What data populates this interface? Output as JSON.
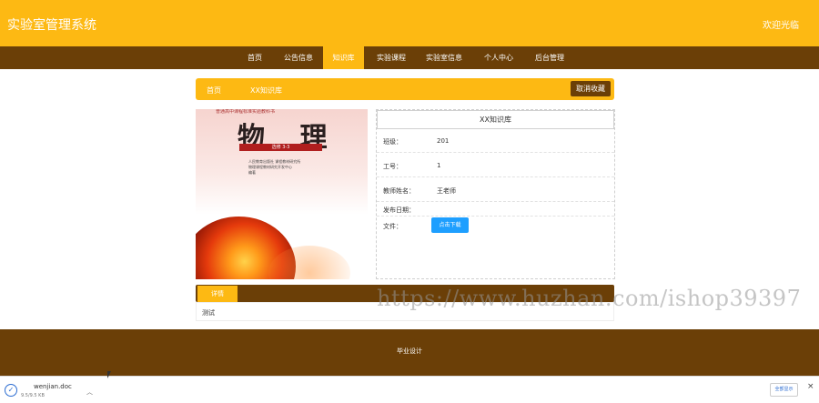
{
  "header": {
    "site_title": "实验室管理系统",
    "welcome": "欢迎光临"
  },
  "nav": {
    "items": [
      "首页",
      "公告信息",
      "知识库",
      "实验课程",
      "实验室信息",
      "个人中心",
      "后台管理"
    ],
    "active_index": 2
  },
  "breadcrumb": {
    "home": "首页",
    "current": "XX知识库",
    "favorite_button": "取消收藏"
  },
  "cover": {
    "top_text": "普通高中课程标准实验教科书",
    "title": "物 理",
    "band_text": "选修 3-3",
    "publisher_line1": "人民教育出版社  课程教材研究所",
    "publisher_line2": "物理课程教材研究开发中心",
    "publisher_suffix": "编著"
  },
  "detail": {
    "heading": "XX知识库",
    "rows": [
      {
        "label": "班级：",
        "value": "201"
      },
      {
        "label": "工号：",
        "value": "1"
      },
      {
        "label": "教师姓名：",
        "value": "王老师"
      },
      {
        "label": "发布日期：",
        "value": ""
      },
      {
        "label": "文件：",
        "value": ""
      }
    ],
    "download_button": "点击下载"
  },
  "tabs": {
    "detail_tab": "详情",
    "detail_text": "测试"
  },
  "footer": {
    "text": "毕业设计"
  },
  "watermark": "https://www.huzhan.com/ishop39397",
  "download_bar": {
    "file_name": "wenjian.doc",
    "file_size": "9.5/9.5 KB",
    "show_all": "全部显示",
    "close": "×"
  },
  "colors": {
    "primary": "#FDB913",
    "secondary": "#6B3F07",
    "button_blue": "#1E9FFF"
  }
}
